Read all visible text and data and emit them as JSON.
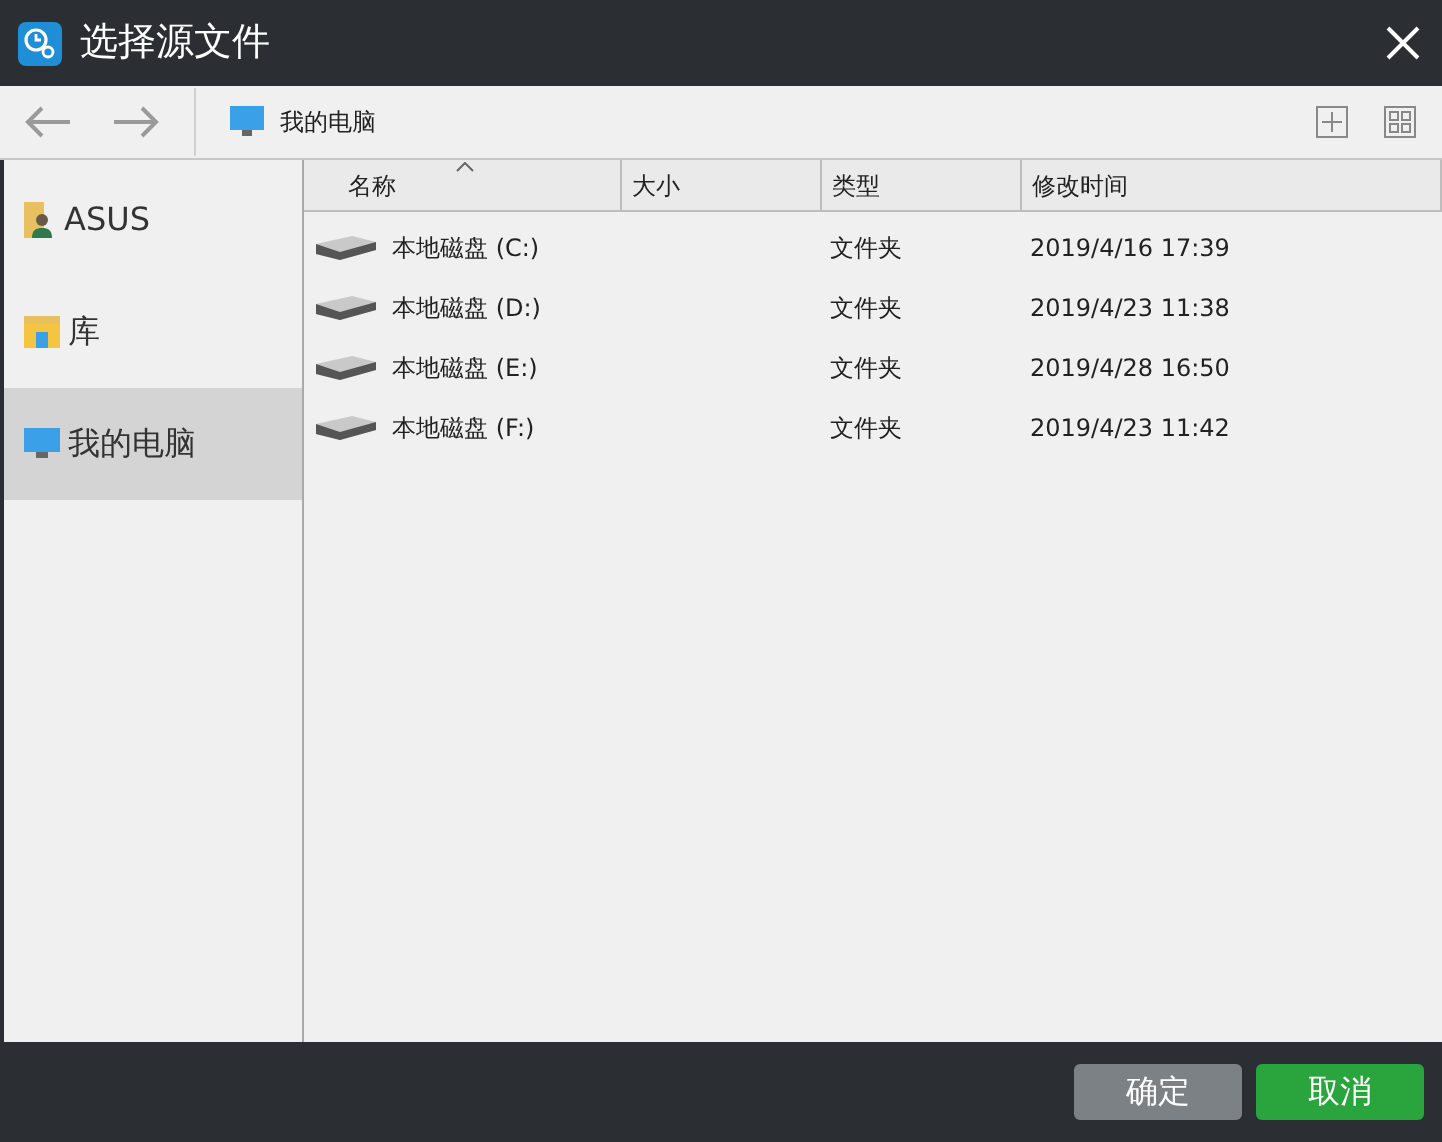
{
  "window": {
    "title": "选择源文件"
  },
  "toolbar": {
    "location": "我的电脑"
  },
  "sidebar": {
    "items": [
      {
        "label": "ASUS",
        "kind": "user",
        "selected": false
      },
      {
        "label": "库",
        "kind": "library",
        "selected": false
      },
      {
        "label": "我的电脑",
        "kind": "computer",
        "selected": true
      }
    ]
  },
  "table": {
    "columns": [
      {
        "label": "名称",
        "sorted": true
      },
      {
        "label": "大小",
        "sorted": false
      },
      {
        "label": "类型",
        "sorted": false
      },
      {
        "label": "修改时间",
        "sorted": false
      }
    ],
    "rows": [
      {
        "name": "本地磁盘 (C:)",
        "type": "文件夹",
        "modified": "2019/4/16 17:39"
      },
      {
        "name": "本地磁盘 (D:)",
        "type": "文件夹",
        "modified": "2019/4/23 11:38"
      },
      {
        "name": "本地磁盘 (E:)",
        "type": "文件夹",
        "modified": "2019/4/28 16:50"
      },
      {
        "name": "本地磁盘 (F:)",
        "type": "文件夹",
        "modified": "2019/4/23 11:42"
      }
    ]
  },
  "buttons": [
    {
      "label": "确定",
      "disabled": true
    },
    {
      "label": "取消",
      "disabled": false
    }
  ]
}
